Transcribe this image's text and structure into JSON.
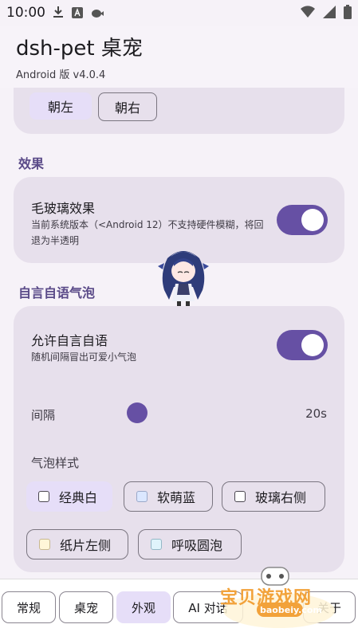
{
  "status": {
    "time": "10:00"
  },
  "app": {
    "title": "dsh-pet 桌宠",
    "subtitle": "Android 版 v4.0.4"
  },
  "direction": {
    "left": "朝左",
    "right": "朝右"
  },
  "effects": {
    "section": "效果",
    "glass_title": "毛玻璃效果",
    "glass_desc": "当前系统版本（<Android 12）不支持硬件模糊，将回退为半透明"
  },
  "bubble": {
    "section": "自言自语气泡",
    "allow_title": "允许自言自语",
    "allow_desc": "随机间隔冒出可爱小气泡",
    "interval_label": "间隔",
    "interval_value": "20s",
    "interval_fraction": 0.0,
    "style_label": "气泡样式",
    "styles": [
      "经典白",
      "软萌蓝",
      "玻璃右侧",
      "纸片左侧",
      "呼吸圆泡"
    ]
  },
  "colors": {
    "accent": "#6650a4",
    "card": "#e7e0ec",
    "selected": "#e6def8",
    "section": "#5a4a88",
    "chip_blue": "#dbe7ff",
    "chip_yellow": "#fff6d8",
    "chip_cyan": "#e0f4fb"
  },
  "nav": [
    "常规",
    "桌宠",
    "外观",
    "AI 对话",
    "关于"
  ],
  "watermark": {
    "text": "宝贝游戏网",
    "url": "baobeiy.com"
  }
}
